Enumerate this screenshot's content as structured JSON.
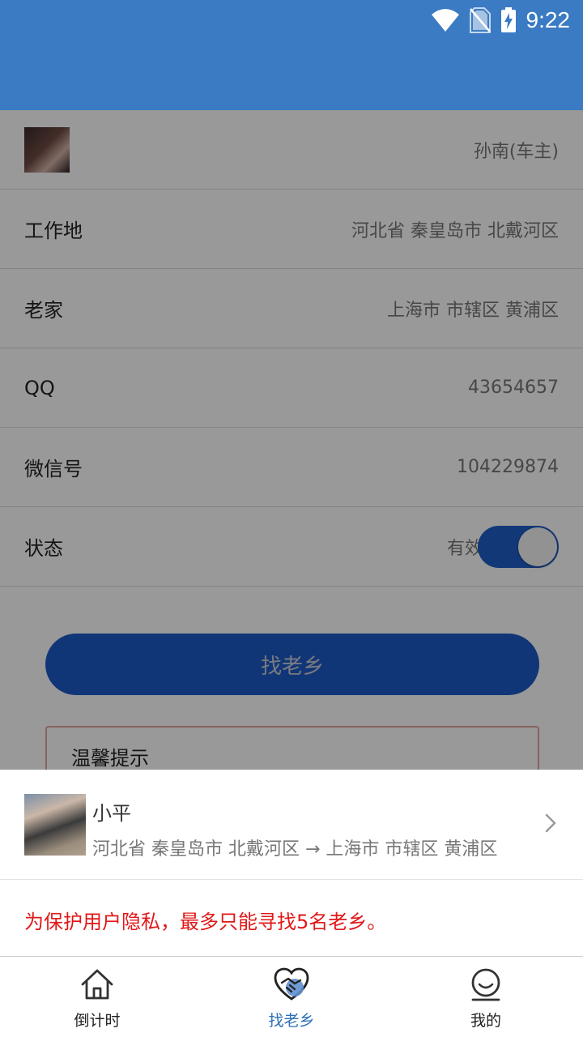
{
  "status_bar": {
    "time": "9:22",
    "icons": [
      "wifi-icon",
      "no-sim-icon",
      "battery-charging-icon"
    ]
  },
  "profile": {
    "owner_name": "孙南(车主)",
    "rows": [
      {
        "label": "工作地",
        "value": "河北省 秦皇岛市 北戴河区"
      },
      {
        "label": "老家",
        "value": "上海市 市辖区 黄浦区"
      },
      {
        "label": "QQ",
        "value": "43654657"
      },
      {
        "label": "微信号",
        "value": "104229874"
      }
    ],
    "status_label": "状态",
    "status_value": "有效",
    "status_enabled": true
  },
  "find_button_label": "找老乡",
  "tip_title": "温馨提示",
  "sheet": {
    "match": {
      "name": "小平",
      "route": "河北省 秦皇岛市 北戴河区 → 上海市 市辖区 黄浦区"
    },
    "privacy_notice": "为保护用户隐私，最多只能寻找5名老乡。"
  },
  "tabs": [
    {
      "label": "倒计时",
      "icon": "house-icon",
      "active": false
    },
    {
      "label": "找老乡",
      "icon": "heart-handshake-icon",
      "active": true
    },
    {
      "label": "我的",
      "icon": "user-face-icon",
      "active": false
    }
  ],
  "colors": {
    "primary": "#3a7bc4",
    "button": "#1d5bc7",
    "active_tab": "#2f6fb8",
    "notice_red": "#e01919"
  }
}
